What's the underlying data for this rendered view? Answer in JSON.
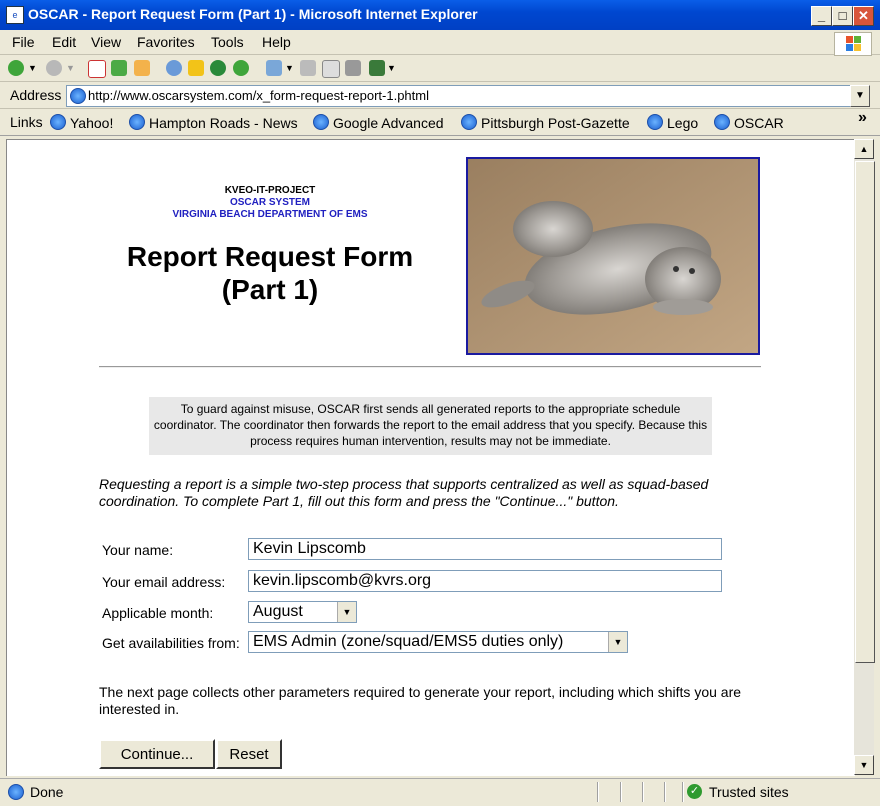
{
  "window": {
    "title": "OSCAR - Report Request Form (Part 1) - Microsoft Internet Explorer",
    "app_icon_label": "e",
    "minimize": "_",
    "maximize": "□",
    "close": "✕"
  },
  "menu": [
    "File",
    "Edit",
    "View",
    "Favorites",
    "Tools",
    "Help"
  ],
  "address": {
    "label": "Address",
    "url": "http://www.oscarsystem.com/x_form-request-report-1.phtml"
  },
  "links": {
    "label": "Links",
    "items": [
      "Yahoo!",
      "Hampton Roads - News",
      "Google Advanced",
      "Pittsburgh Post-Gazette",
      "Lego",
      "OSCAR"
    ],
    "overflow": "»"
  },
  "page": {
    "org_lines": [
      "KVEO-IT-PROJECT",
      "OSCAR SYSTEM",
      "VIRGINIA BEACH DEPARTMENT OF EMS"
    ],
    "title_line1": "Report Request Form",
    "title_line2": "(Part 1)",
    "notice": "To guard against misuse, OSCAR first sends all generated reports to the appropriate schedule coordinator.  The coordinator then forwards the report to the email address that you specify. Because this process requires human intervention, results may not be immediate.",
    "intro": "Requesting a report is a simple two-step process that supports centralized as well as squad-based coordination.  To complete Part 1, fill out this form and press the \"Continue...\" button.",
    "form": {
      "name_label": "Your name:",
      "name_value": "Kevin Lipscomb",
      "email_label": "Your email address:",
      "email_value": "kevin.lipscomb@kvrs.org",
      "month_label": "Applicable month:",
      "month_value": "August",
      "avail_label": "Get availabilities from:",
      "avail_value": "EMS Admin (zone/squad/EMS5 duties only)"
    },
    "footer_note": "The next page collects other parameters required to generate your report, including which shifts you are interested in.",
    "continue_button": "Continue...",
    "reset_button": "Reset"
  },
  "status": {
    "text": "Done",
    "zone": "Trusted sites"
  },
  "colors": {
    "titlebar": "#0a5ee8",
    "org_blue": "#2020c0",
    "image_border": "#1a1aa0"
  }
}
